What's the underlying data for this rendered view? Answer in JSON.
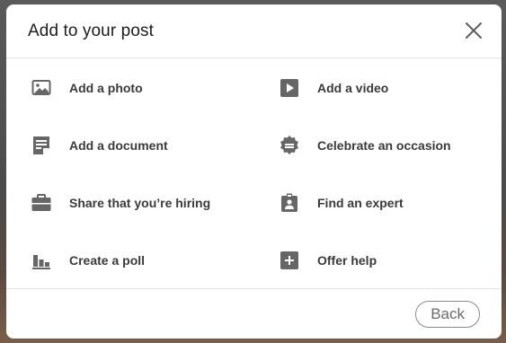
{
  "modal": {
    "title": "Add to your post",
    "close_label": "Close"
  },
  "options": [
    {
      "label": "Add a photo",
      "icon": "photo-icon"
    },
    {
      "label": "Add a video",
      "icon": "video-icon"
    },
    {
      "label": "Add a document",
      "icon": "document-icon"
    },
    {
      "label": "Celebrate an occasion",
      "icon": "celebrate-icon"
    },
    {
      "label": "Share that you’re hiring",
      "icon": "briefcase-icon"
    },
    {
      "label": "Find an expert",
      "icon": "expert-icon"
    },
    {
      "label": "Create a poll",
      "icon": "poll-icon"
    },
    {
      "label": "Offer help",
      "icon": "plus-icon"
    }
  ],
  "footer": {
    "back_label": "Back"
  },
  "colors": {
    "icon": "#666666",
    "label": "#3a3a3a",
    "title": "#1d1d1d"
  }
}
